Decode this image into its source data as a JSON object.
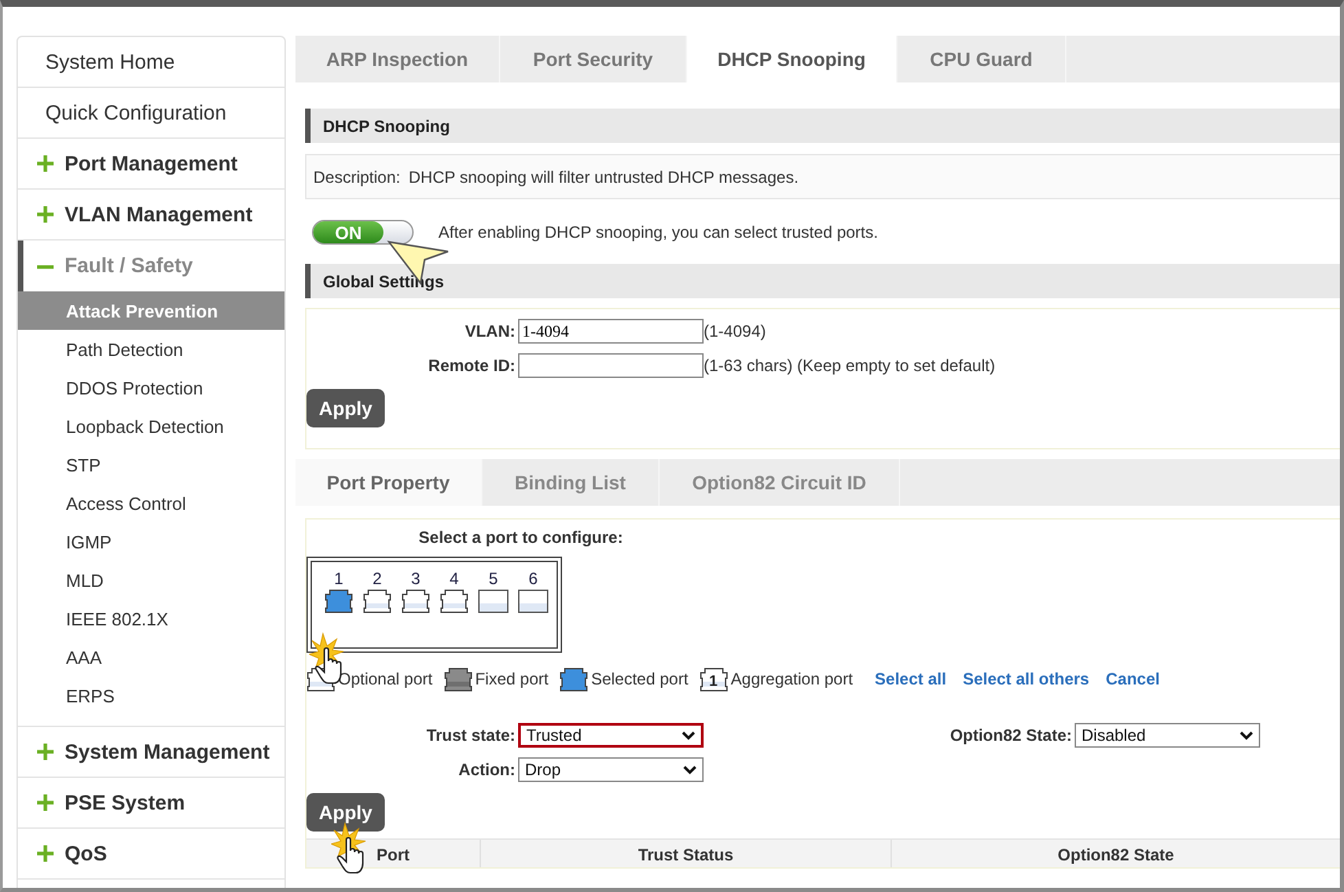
{
  "sidebar": {
    "items": [
      {
        "label": "System Home",
        "kind": "link"
      },
      {
        "label": "Quick Configuration",
        "kind": "link"
      },
      {
        "label": "Port Management",
        "kind": "group",
        "expanded": false
      },
      {
        "label": "VLAN Management",
        "kind": "group",
        "expanded": false
      },
      {
        "label": "Fault / Safety",
        "kind": "group",
        "expanded": true,
        "children": [
          {
            "label": "Attack Prevention",
            "selected": true
          },
          {
            "label": "Path Detection",
            "selected": false
          },
          {
            "label": "DDOS Protection",
            "selected": false
          },
          {
            "label": "Loopback Detection",
            "selected": false
          },
          {
            "label": "STP",
            "selected": false
          },
          {
            "label": "Access Control",
            "selected": false
          },
          {
            "label": "IGMP",
            "selected": false
          },
          {
            "label": "MLD",
            "selected": false
          },
          {
            "label": "IEEE 802.1X",
            "selected": false
          },
          {
            "label": "AAA",
            "selected": false
          },
          {
            "label": "ERPS",
            "selected": false
          }
        ]
      },
      {
        "label": "System Management",
        "kind": "group",
        "expanded": false
      },
      {
        "label": "PSE System",
        "kind": "group",
        "expanded": false
      },
      {
        "label": "QoS",
        "kind": "group",
        "expanded": false
      }
    ]
  },
  "tabs": [
    {
      "label": "ARP Inspection",
      "selected": false
    },
    {
      "label": "Port Security",
      "selected": false
    },
    {
      "label": "DHCP Snooping",
      "selected": true
    },
    {
      "label": "CPU Guard",
      "selected": false
    }
  ],
  "dhcp_section": {
    "title": "DHCP Snooping",
    "description_label": "Description:",
    "description": "DHCP snooping will filter untrusted DHCP messages.",
    "toggle": {
      "on": true,
      "label": "ON"
    },
    "toggle_hint": "After enabling DHCP snooping, you can select trusted ports."
  },
  "global_settings": {
    "title": "Global Settings",
    "fields": [
      {
        "label": "VLAN:",
        "value": "1-4094",
        "hint": "(1-4094)"
      },
      {
        "label": "Remote ID:",
        "hint": "(1-63 chars) (Keep empty to set default)"
      }
    ],
    "apply": "Apply"
  },
  "sub_tabs": [
    {
      "label": "Port Property",
      "selected": true
    },
    {
      "label": "Binding List",
      "selected": false
    },
    {
      "label": "Option82 Circuit ID",
      "selected": false
    }
  ],
  "port_panel": {
    "prompt": "Select a port to configure:",
    "ports": [
      {
        "number": "1",
        "kind": "rj45",
        "selected": true
      },
      {
        "number": "2",
        "kind": "rj45",
        "selected": false
      },
      {
        "number": "3",
        "kind": "rj45",
        "selected": false
      },
      {
        "number": "4",
        "kind": "rj45",
        "selected": false
      },
      {
        "number": "5",
        "kind": "sfp",
        "selected": false
      },
      {
        "number": "6",
        "kind": "sfp",
        "selected": false
      }
    ],
    "legend": [
      {
        "kind": "optional",
        "label": "Optional port"
      },
      {
        "kind": "fixed",
        "label": "Fixed port"
      },
      {
        "kind": "selected",
        "label": "Selected port"
      },
      {
        "kind": "aggregation",
        "badge": "1",
        "label": "Aggregation port"
      }
    ],
    "links": [
      "Select all",
      "Select all others",
      "Cancel"
    ],
    "trust_state": {
      "label": "Trust state:",
      "value": "Trusted",
      "highlighted": true
    },
    "option82_state": {
      "label": "Option82 State:",
      "value": "Disabled",
      "highlighted": false
    },
    "action": {
      "label": "Action:",
      "value": "Drop",
      "highlighted": false
    },
    "apply": "Apply"
  },
  "table": {
    "columns": [
      "Port",
      "Trust Status",
      "Option82 State"
    ]
  }
}
